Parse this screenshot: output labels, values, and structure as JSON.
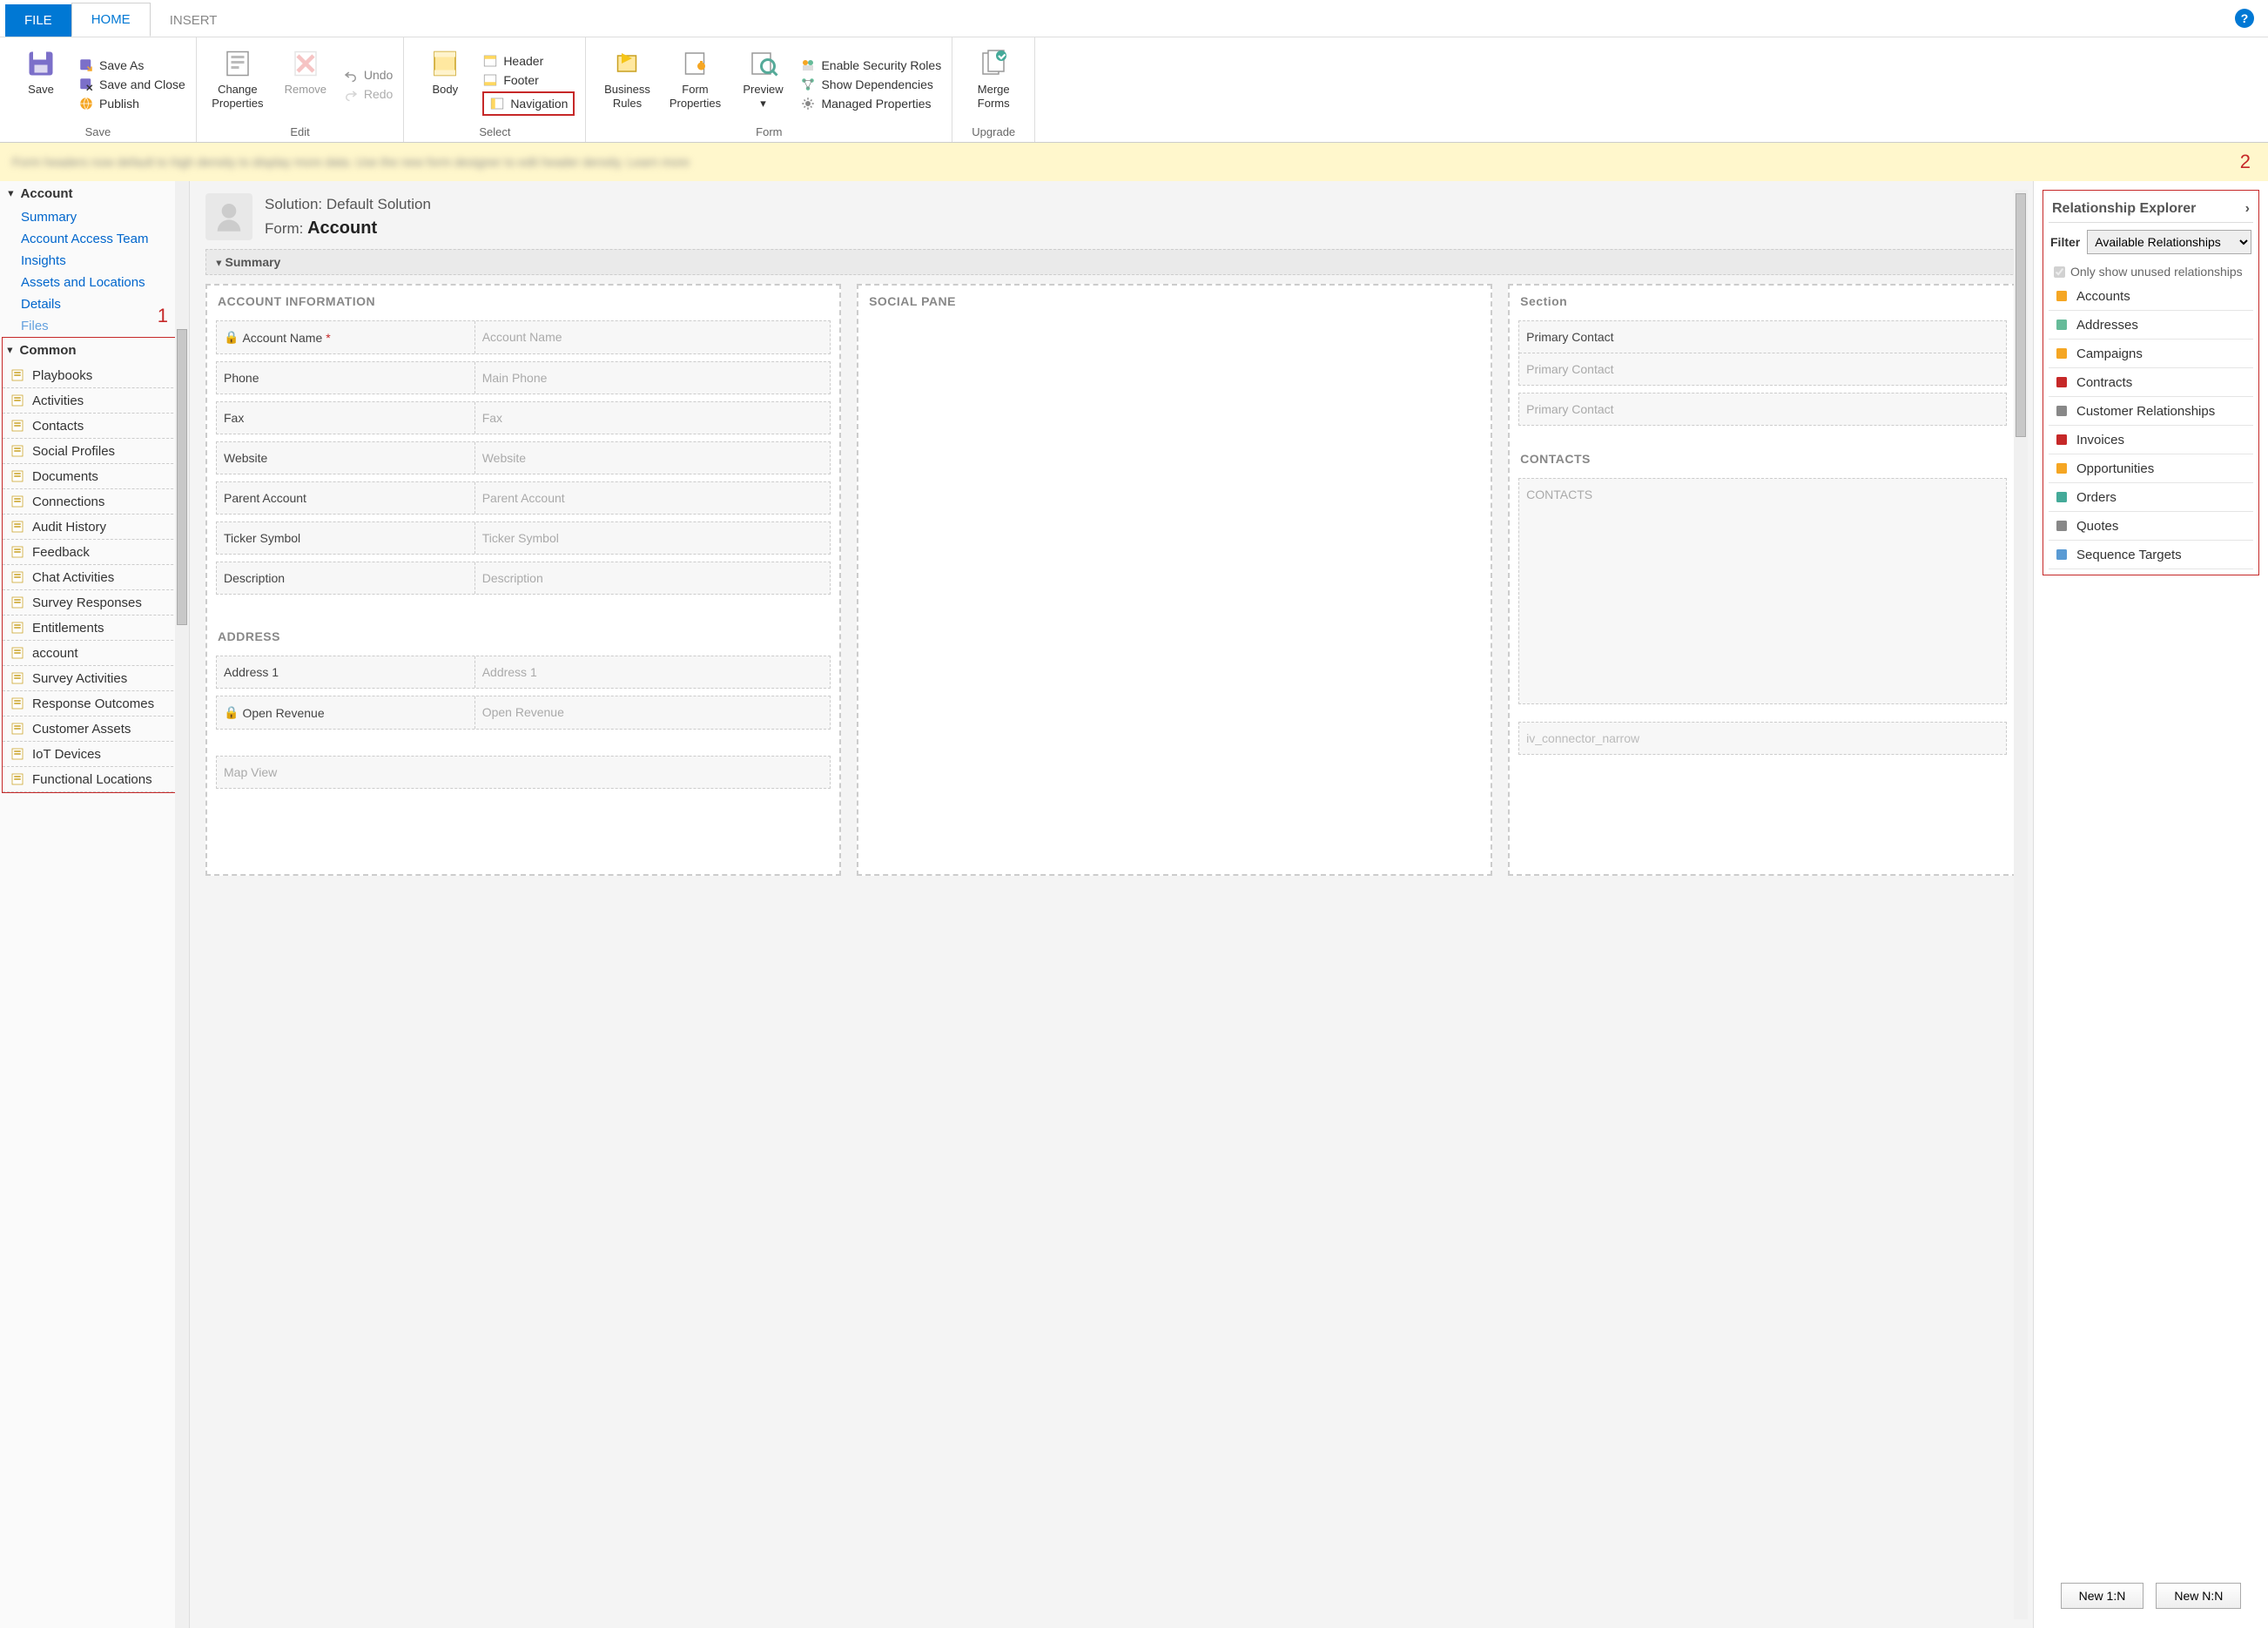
{
  "tabs": {
    "file": "FILE",
    "home": "HOME",
    "insert": "INSERT"
  },
  "ribbon": {
    "save_group": "Save",
    "save": "Save",
    "save_as": "Save As",
    "save_close": "Save and Close",
    "publish": "Publish",
    "edit_group": "Edit",
    "change_props": "Change\nProperties",
    "remove": "Remove",
    "undo": "Undo",
    "redo": "Redo",
    "select_group": "Select",
    "body": "Body",
    "header": "Header",
    "footer": "Footer",
    "navigation": "Navigation",
    "form_group": "Form",
    "biz_rules": "Business\nRules",
    "form_props": "Form\nProperties",
    "preview": "Preview",
    "enable_sec": "Enable Security Roles",
    "show_deps": "Show Dependencies",
    "managed_props": "Managed Properties",
    "upgrade_group": "Upgrade",
    "merge_forms": "Merge\nForms"
  },
  "annotations": {
    "one": "1",
    "two": "2"
  },
  "infobar": "Form headers now default to high density to display more data. Use the new form designer to edit header density. Learn more",
  "left": {
    "account": "Account",
    "items": [
      "Summary",
      "Account Access Team",
      "Insights",
      "Assets and Locations",
      "Details",
      "Files"
    ],
    "common": "Common",
    "common_items": [
      "Playbooks",
      "Activities",
      "Contacts",
      "Social Profiles",
      "Documents",
      "Connections",
      "Audit History",
      "Feedback",
      "Chat Activities",
      "Survey Responses",
      "Entitlements",
      "account",
      "Survey Activities",
      "Response Outcomes",
      "Customer Assets",
      "IoT Devices",
      "Functional Locations"
    ]
  },
  "center": {
    "solution_label": "Solution: ",
    "solution": "Default Solution",
    "form_label": "Form: ",
    "form_name": "Account",
    "summary": "Summary",
    "sec_account_info": "ACCOUNT INFORMATION",
    "fields_account": [
      {
        "label": "Account Name",
        "placeholder": "Account Name",
        "required": true,
        "locked": true
      },
      {
        "label": "Phone",
        "placeholder": "Main Phone"
      },
      {
        "label": "Fax",
        "placeholder": "Fax"
      },
      {
        "label": "Website",
        "placeholder": "Website"
      },
      {
        "label": "Parent Account",
        "placeholder": "Parent Account"
      },
      {
        "label": "Ticker Symbol",
        "placeholder": "Ticker Symbol"
      },
      {
        "label": "Description",
        "placeholder": "Description"
      }
    ],
    "sec_address": "ADDRESS",
    "fields_address": [
      {
        "label": "Address 1",
        "placeholder": "Address 1"
      },
      {
        "label": "Open Revenue",
        "placeholder": "Open Revenue",
        "locked": true
      }
    ],
    "map_view": "Map View",
    "social_pane": "SOCIAL PANE",
    "section": "Section",
    "primary_contact_lbl": "Primary Contact",
    "primary_contact_ph": "Primary Contact",
    "contacts_h": "CONTACTS",
    "contacts_ph": "CONTACTS",
    "iv_conn": "iv_connector_narrow"
  },
  "right": {
    "title": "Relationship Explorer",
    "filter_label": "Filter",
    "filter_value": "Available Relationships",
    "only_unused": "Only show unused relationships",
    "items": [
      "Accounts",
      "Addresses",
      "Campaigns",
      "Contracts",
      "Customer Relationships",
      "Invoices",
      "Opportunities",
      "Orders",
      "Quotes",
      "Sequence Targets"
    ],
    "new_1n": "New 1:N",
    "new_nn": "New N:N"
  }
}
